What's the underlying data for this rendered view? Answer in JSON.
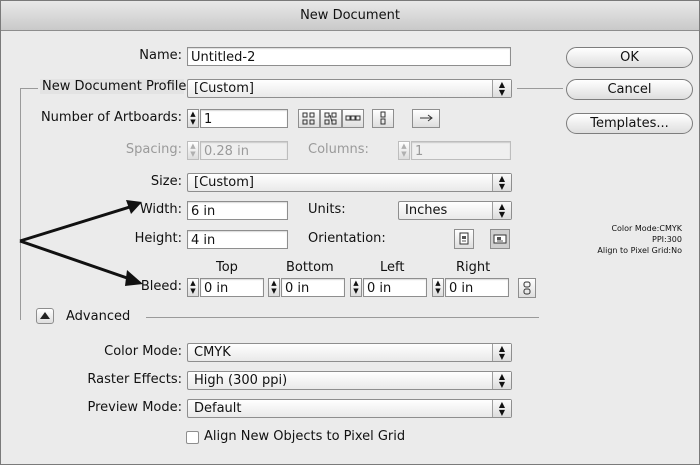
{
  "window": {
    "title": "New Document"
  },
  "name": {
    "label": "Name:",
    "value": "Untitled-2"
  },
  "profile": {
    "label": "New Document Profile:",
    "value": "[Custom]"
  },
  "artboards": {
    "label": "Number of Artboards:",
    "value": "1"
  },
  "spacing": {
    "label": "Spacing:",
    "value": "0.28 in"
  },
  "columns": {
    "label": "Columns:",
    "value": "1"
  },
  "size": {
    "label": "Size:",
    "value": "[Custom]"
  },
  "width": {
    "label": "Width:",
    "value": "6 in"
  },
  "units": {
    "label": "Units:",
    "value": "Inches"
  },
  "height": {
    "label": "Height:",
    "value": "4 in"
  },
  "orientation": {
    "label": "Orientation:"
  },
  "bleed": {
    "label": "Bleed:",
    "headers": {
      "top": "Top",
      "bottom": "Bottom",
      "left": "Left",
      "right": "Right"
    },
    "values": {
      "top": "0 in",
      "bottom": "0 in",
      "left": "0 in",
      "right": "0 in"
    }
  },
  "advanced": {
    "label": "Advanced"
  },
  "color_mode": {
    "label": "Color Mode:",
    "value": "CMYK"
  },
  "raster_effects": {
    "label": "Raster Effects:",
    "value": "High (300 ppi)"
  },
  "preview_mode": {
    "label": "Preview Mode:",
    "value": "Default"
  },
  "align_pixel_grid": {
    "label": "Align New Objects to Pixel Grid",
    "checked": false
  },
  "buttons": {
    "ok": "OK",
    "cancel": "Cancel",
    "templates": "Templates..."
  },
  "summary": {
    "line1": "Color Mode:CMYK",
    "line2": "PPI:300",
    "line3": "Align to Pixel Grid:No"
  }
}
